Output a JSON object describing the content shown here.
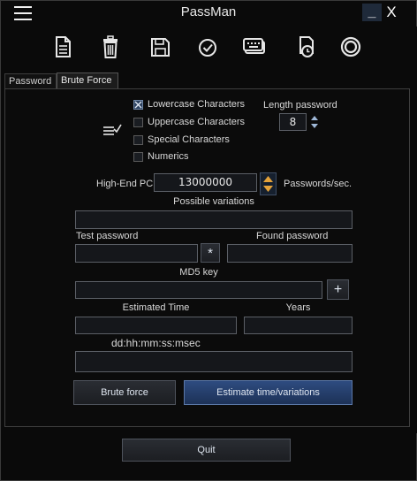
{
  "app": {
    "title": "PassMan"
  },
  "window": {
    "minimize": "_",
    "close": "X"
  },
  "toolbar": {
    "icons": [
      "new-document-icon",
      "delete-icon",
      "save-icon",
      "check-circle-icon",
      "keyboard-icon",
      "history-icon",
      "settings-ring-icon"
    ]
  },
  "tabs": [
    {
      "label": "Password"
    },
    {
      "label": "Brute Force"
    }
  ],
  "options": {
    "lowercase": {
      "label": "Lowercase Characters",
      "checked": true
    },
    "uppercase": {
      "label": "Uppercase Characters",
      "checked": false
    },
    "special": {
      "label": "Special Characters",
      "checked": false
    },
    "numerics": {
      "label": "Numerics",
      "checked": false
    },
    "length_label": "Length password",
    "length_value": "8"
  },
  "speed": {
    "machine_label": "High-End PC",
    "value": "13000000",
    "unit": "Passwords/sec."
  },
  "labels": {
    "possible_variations": "Possible variations",
    "test_password": "Test password",
    "found_password": "Found password",
    "md5_key": "MD5 key",
    "estimated_time": "Estimated Time",
    "years": "Years",
    "time_format": "dd:hh:mm:ss:msec"
  },
  "buttons": {
    "mask": "*",
    "add": "+",
    "brute_force": "Brute force",
    "estimate": "Estimate time/variations",
    "quit": "Quit"
  },
  "colors": {
    "accent": "#2e4c80",
    "background": "#0a0a0a"
  }
}
